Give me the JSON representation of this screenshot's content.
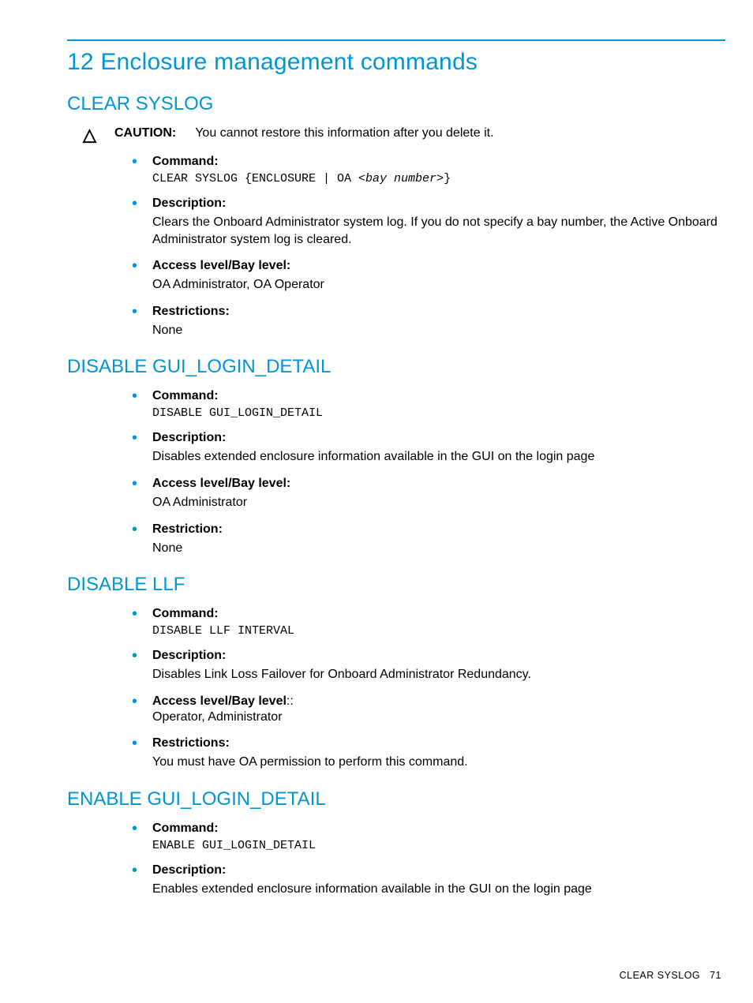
{
  "page": {
    "chapter_number": "12",
    "chapter_title": "Enclosure management commands",
    "footer_text": "CLEAR SYSLOG",
    "footer_page": "71"
  },
  "caution": {
    "label": "CAUTION:",
    "text": "You cannot restore this information after you delete it."
  },
  "sections": [
    {
      "title": "CLEAR SYSLOG",
      "has_caution": true,
      "items": [
        {
          "label": "Command:",
          "code": "CLEAR SYSLOG {ENCLOSURE | OA <",
          "code_em": "bay number",
          "code_after": ">}"
        },
        {
          "label": "Description:",
          "body": "Clears the Onboard Administrator system log. If you do not specify a bay number, the Active Onboard Administrator system log is cleared."
        },
        {
          "label": "Access level/Bay level:",
          "body": "OA Administrator, OA Operator"
        },
        {
          "label": "Restrictions:",
          "body": "None"
        }
      ]
    },
    {
      "title": "DISABLE GUI_LOGIN_DETAIL",
      "items": [
        {
          "label": "Command:",
          "code": "DISABLE GUI_LOGIN_DETAIL"
        },
        {
          "label": "Description:",
          "body": "Disables extended enclosure information available in the GUI on the login page"
        },
        {
          "label": "Access level/Bay level:",
          "body": "OA Administrator"
        },
        {
          "label": "Restriction:",
          "body": "None"
        }
      ]
    },
    {
      "title": "DISABLE LLF",
      "items": [
        {
          "label": "Command:",
          "code": "DISABLE LLF INTERVAL"
        },
        {
          "label": "Description:",
          "body": "Disables Link Loss Failover for Onboard Administrator Redundancy."
        },
        {
          "label": "Access level/Bay level",
          "label_suffix": "::",
          "body": "Operator, Administrator"
        },
        {
          "label": "Restrictions:",
          "body": "You must have OA permission to perform this command."
        }
      ]
    },
    {
      "title": "ENABLE GUI_LOGIN_DETAIL",
      "items": [
        {
          "label": "Command:",
          "code": "ENABLE GUI_LOGIN_DETAIL"
        },
        {
          "label": "Description:",
          "body": "Enables extended enclosure information available in the GUI on the login page"
        }
      ]
    }
  ]
}
